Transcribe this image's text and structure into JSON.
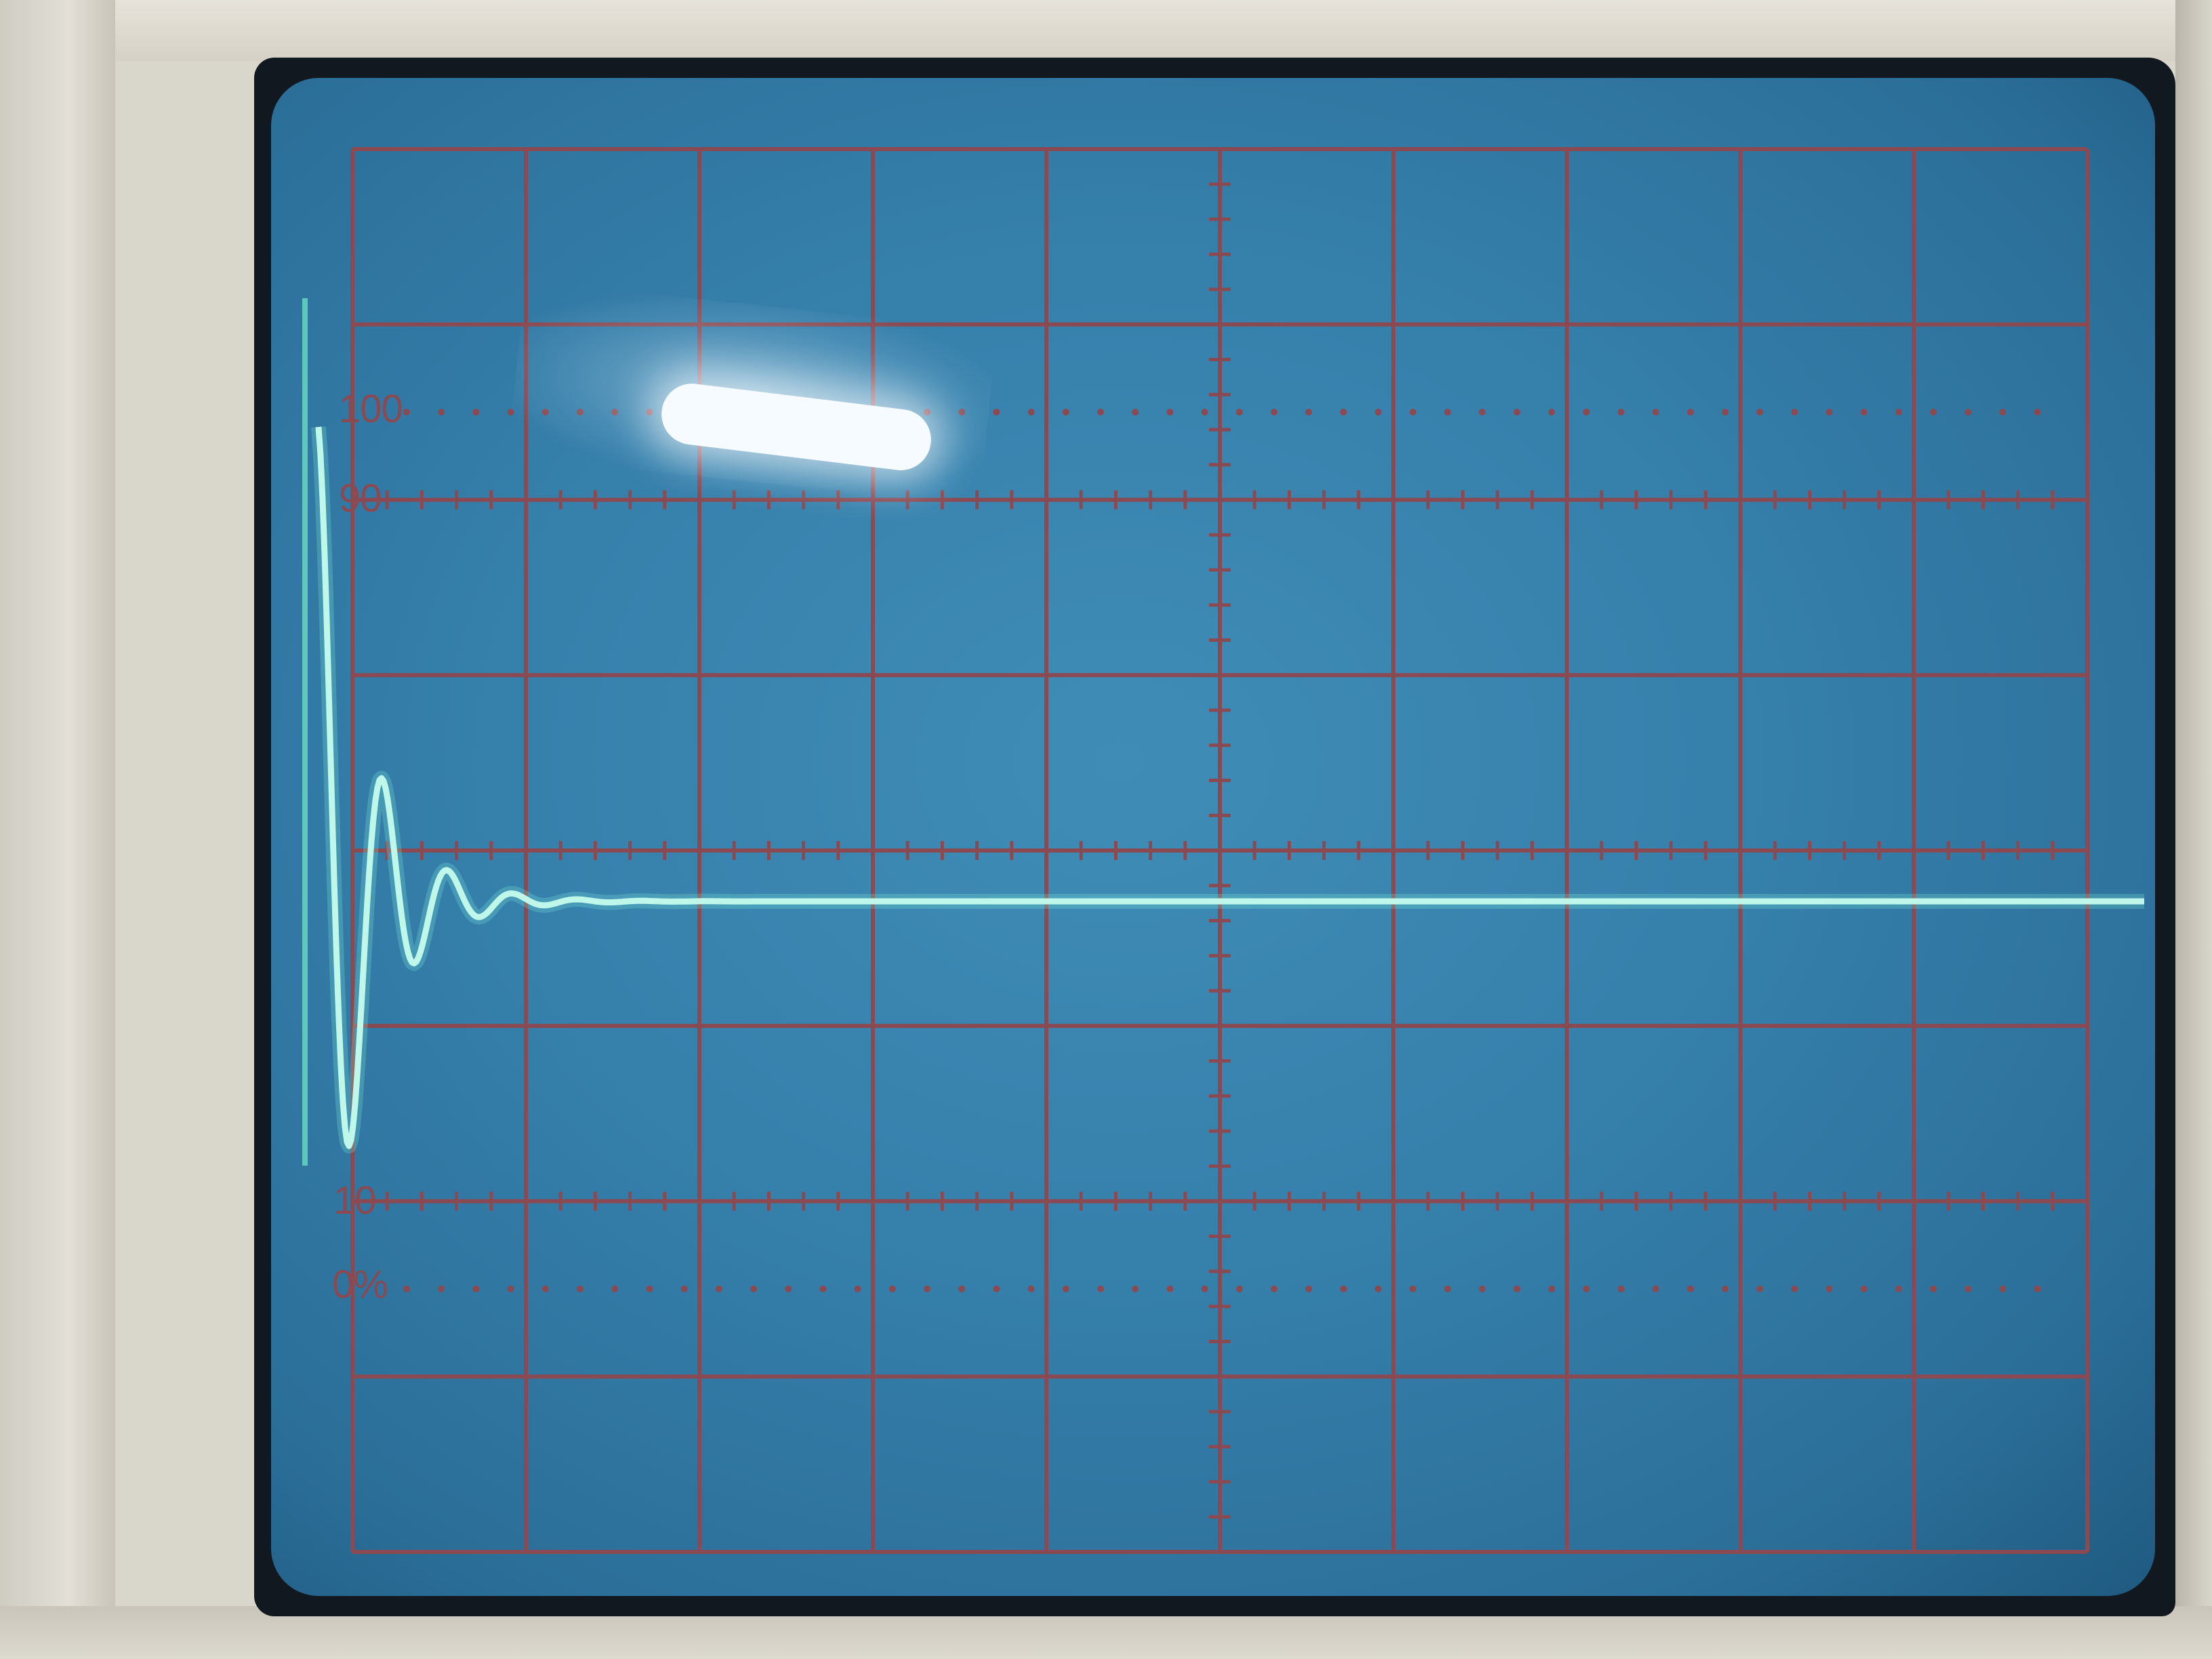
{
  "scene": "oscilloscope-screen",
  "graticule": {
    "label_100": "100",
    "label_90": "90",
    "label_10": "10",
    "label_0": "0%"
  },
  "colors": {
    "screen": "#357fab",
    "grid": "#8b4a52",
    "trace": "#bff7ea"
  }
}
